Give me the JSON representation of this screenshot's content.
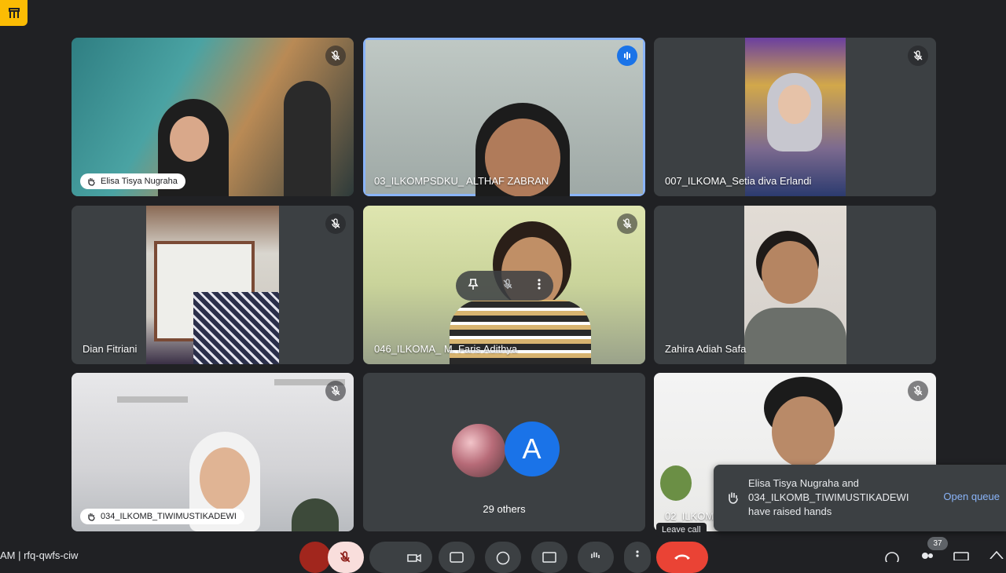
{
  "participants": [
    {
      "name": "Elisa Tisya Nugraha",
      "raised_hand": true
    },
    {
      "name": "03_ILKOMPSDKU_ ALTHAF ZABRAN",
      "speaking": true
    },
    {
      "name": "007_ILKOMA_Setia diva Erlandi"
    },
    {
      "name": "Dian Fitriani"
    },
    {
      "name": "046_ILKOMA_ M. Faris Adithya"
    },
    {
      "name": "Zahira Adiah Safa"
    },
    {
      "name": "034_ILKOMB_TIWIMUSTIKADEWI",
      "raised_hand": true
    },
    {
      "name": "02_ILKOM"
    }
  ],
  "others": {
    "avatar_letter": "A",
    "label": "29 others"
  },
  "notification": {
    "text": "Elisa Tisya Nugraha and 034_ILKOMB_TIWIMUSTIKADEWI have raised hands",
    "action": "Open queue"
  },
  "tooltip": "Leave call",
  "people_count": "37",
  "bottom_left": "AM  |  rfq-qwfs-ciw",
  "colors": {
    "accent": "#8ab4f8",
    "leave": "#ea4335",
    "speaking": "#1a73e8"
  }
}
